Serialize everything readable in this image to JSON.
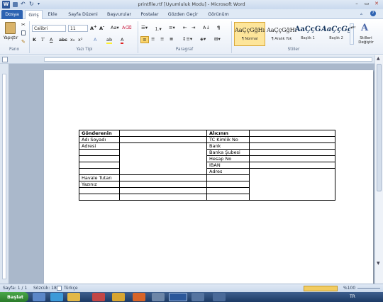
{
  "window": {
    "title": "printfile.rtf [Uyumluluk Modu] - Microsoft Word"
  },
  "tabs": [
    "Dosya",
    "Giriş",
    "Ekle",
    "Sayfa Düzeni",
    "Başvurular",
    "Postalar",
    "Gözden Geçir",
    "Görünüm"
  ],
  "ribbon": {
    "clipboard": {
      "paste_label": "Yapıştır",
      "group": "Pano"
    },
    "font": {
      "name": "Calibri",
      "size": "11",
      "group": "Yazı Tipi"
    },
    "paragraph": {
      "group": "Paragraf"
    },
    "styles": {
      "group": "Stiller",
      "items": [
        {
          "sample": "AaÇçĞğHı",
          "label": "¶ Normal"
        },
        {
          "sample": "AaÇçĞğHı",
          "label": "¶ Aralık Yok"
        },
        {
          "sample": "AaÇçĞ",
          "label": "Başlık 1"
        },
        {
          "sample": "AaÇçĞǵ",
          "label": "Başlık 2"
        }
      ],
      "change_label": "Stilleri Değiştir"
    }
  },
  "document": {
    "table": [
      [
        "Gönderenin",
        "",
        "Alıcının",
        ""
      ],
      [
        "Adı Soyadı",
        "",
        "TC Kimlik No",
        ""
      ],
      [
        "Adresi",
        "",
        "Bank",
        ""
      ],
      [
        "",
        "",
        "Banka Şubesi",
        ""
      ],
      [
        "",
        "",
        "Hesap No",
        ""
      ],
      [
        "",
        "",
        "IBAN",
        ""
      ],
      [
        "",
        "",
        "Adres",
        ""
      ],
      [
        "Havale Tutarı",
        "",
        "",
        ""
      ],
      [
        "Yazınız",
        "",
        "",
        ""
      ],
      [
        "",
        "",
        "",
        ""
      ],
      [
        "",
        "",
        "",
        ""
      ]
    ]
  },
  "status": {
    "page": "Sayfa: 1 / 1",
    "words": "Sözcük: 18",
    "lang": "Türkçe",
    "zoom": "%100"
  },
  "taskbar": {
    "start": "Başlat",
    "lang": "TR"
  },
  "colors": {
    "file_tab": "#2d63b2",
    "word_blue": "#2b579a"
  }
}
